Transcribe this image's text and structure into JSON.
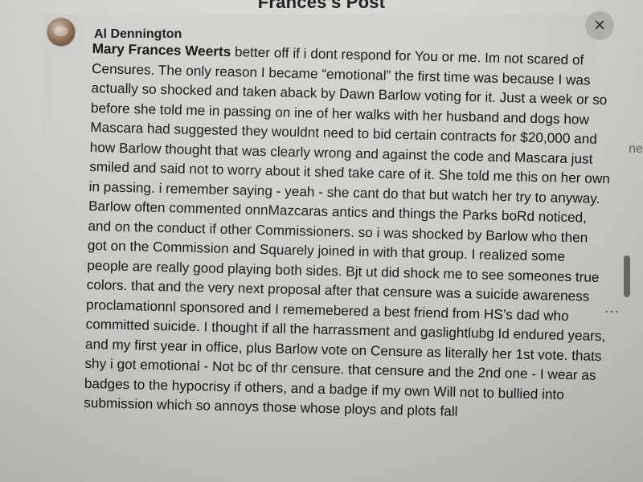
{
  "header": {
    "title": "Frances's Post",
    "close_icon": "×"
  },
  "post": {
    "author_name": "Al Dennington",
    "comment_target": "Mary Frances Weerts",
    "comment_text": " better off if i dont respond for You or me. Im not scared of Censures. The only reason I became “emotional” the first time was because I was actually so shocked and taken aback by Dawn Barlow voting for it. Just a week or so before she told me in passing on ine of her walks with her husband and dogs how Mascara had suggested they wouldnt need to bid certain contracts for $20,000 and how Barlow thought that was clearly wrong and against the code and Mascara just smiled and said not to worry about it shed take care of it. She told me this on her own in passing. i remember saying - yeah - she cant do that but watch her try to anyway. Barlow often commented onnMazcaras antics and things the Parks boRd noticed, and on the conduct if other Commissioners. so i was shocked by Barlow who then got on the Commission and Squarely joined in with that group. I realized some people are really good playing both sides. Bjt ut did shock me to see someones true colors. that and the very next proposal after that censure was a suicide awareness proclamationnl sponsored and I rememebered a best friend from HS’s dad who committed suicide. I thought if all the harrassment and gaslightlubg Id endured years, and my first year in office, plus Barlow vote on Censure as literally her 1st vote. thats shy i got emotional - Not bc of thr censure. that censure and the 2nd one - I wear as badges to the hypocrisy if others, and a badge if my own Will not to bullied into submission which so annoys those whose ploys and plots fall"
  },
  "ui": {
    "more_options": "…",
    "right_edge_text": "ne"
  },
  "icons": {
    "close": "close-icon",
    "avatar": "avatar",
    "more": "more-options-icon"
  }
}
